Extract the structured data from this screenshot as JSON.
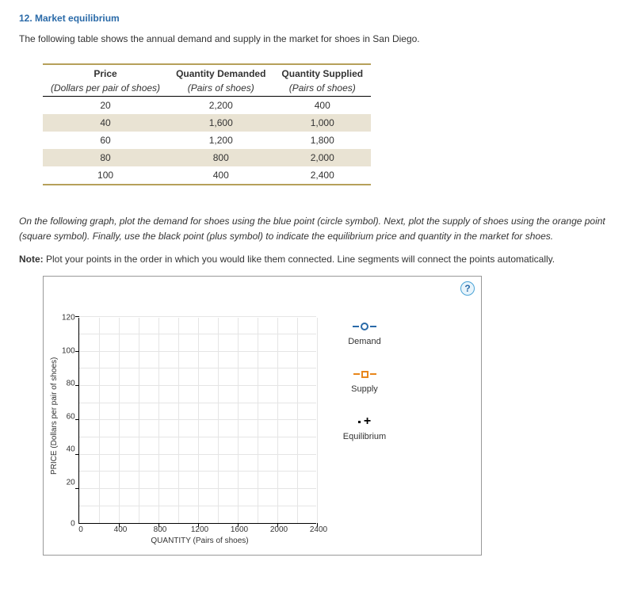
{
  "heading": "12. Market equilibrium",
  "intro": "The following table shows the annual demand and supply in the market for shoes in San Diego.",
  "table": {
    "head1": [
      "Price",
      "Quantity Demanded",
      "Quantity Supplied"
    ],
    "head2": [
      "(Dollars per pair of shoes)",
      "(Pairs of shoes)",
      "(Pairs of shoes)"
    ],
    "rows": [
      [
        "20",
        "2,200",
        "400"
      ],
      [
        "40",
        "1,600",
        "1,000"
      ],
      [
        "60",
        "1,200",
        "1,800"
      ],
      [
        "80",
        "800",
        "2,000"
      ],
      [
        "100",
        "400",
        "2,400"
      ]
    ]
  },
  "instructions": "On the following graph, plot the demand for shoes using the blue point (circle symbol). Next, plot the supply of shoes using the orange point (square symbol). Finally, use the black point (plus symbol) to indicate the equilibrium price and quantity in the market for shoes.",
  "note_label": "Note:",
  "note_text": " Plot your points in the order in which you would like them connected. Line segments will connect the points automatically.",
  "help": "?",
  "legend": {
    "demand": "Demand",
    "supply": "Supply",
    "equilibrium": "Equilibrium"
  },
  "axes": {
    "ylabel": "PRICE (Dollars per pair of shoes)",
    "xlabel": "QUANTITY (Pairs of shoes)",
    "yticks": [
      "120",
      "100",
      "80",
      "60",
      "40",
      "20",
      "0"
    ],
    "xticks": [
      "0",
      "400",
      "800",
      "1200",
      "1600",
      "2000",
      "2400"
    ]
  },
  "chart_data": {
    "type": "scatter",
    "title": "",
    "xlabel": "QUANTITY (Pairs of shoes)",
    "ylabel": "PRICE (Dollars per pair of shoes)",
    "xlim": [
      0,
      2400
    ],
    "ylim": [
      0,
      120
    ],
    "grid": true,
    "series": [
      {
        "name": "Demand",
        "color": "#2a6aa8",
        "symbol": "circle",
        "x": [],
        "y": []
      },
      {
        "name": "Supply",
        "color": "#e8861b",
        "symbol": "square",
        "x": [],
        "y": []
      },
      {
        "name": "Equilibrium",
        "color": "#000000",
        "symbol": "plus",
        "x": [],
        "y": []
      }
    ],
    "note": "graph shown empty (no points plotted yet)"
  }
}
